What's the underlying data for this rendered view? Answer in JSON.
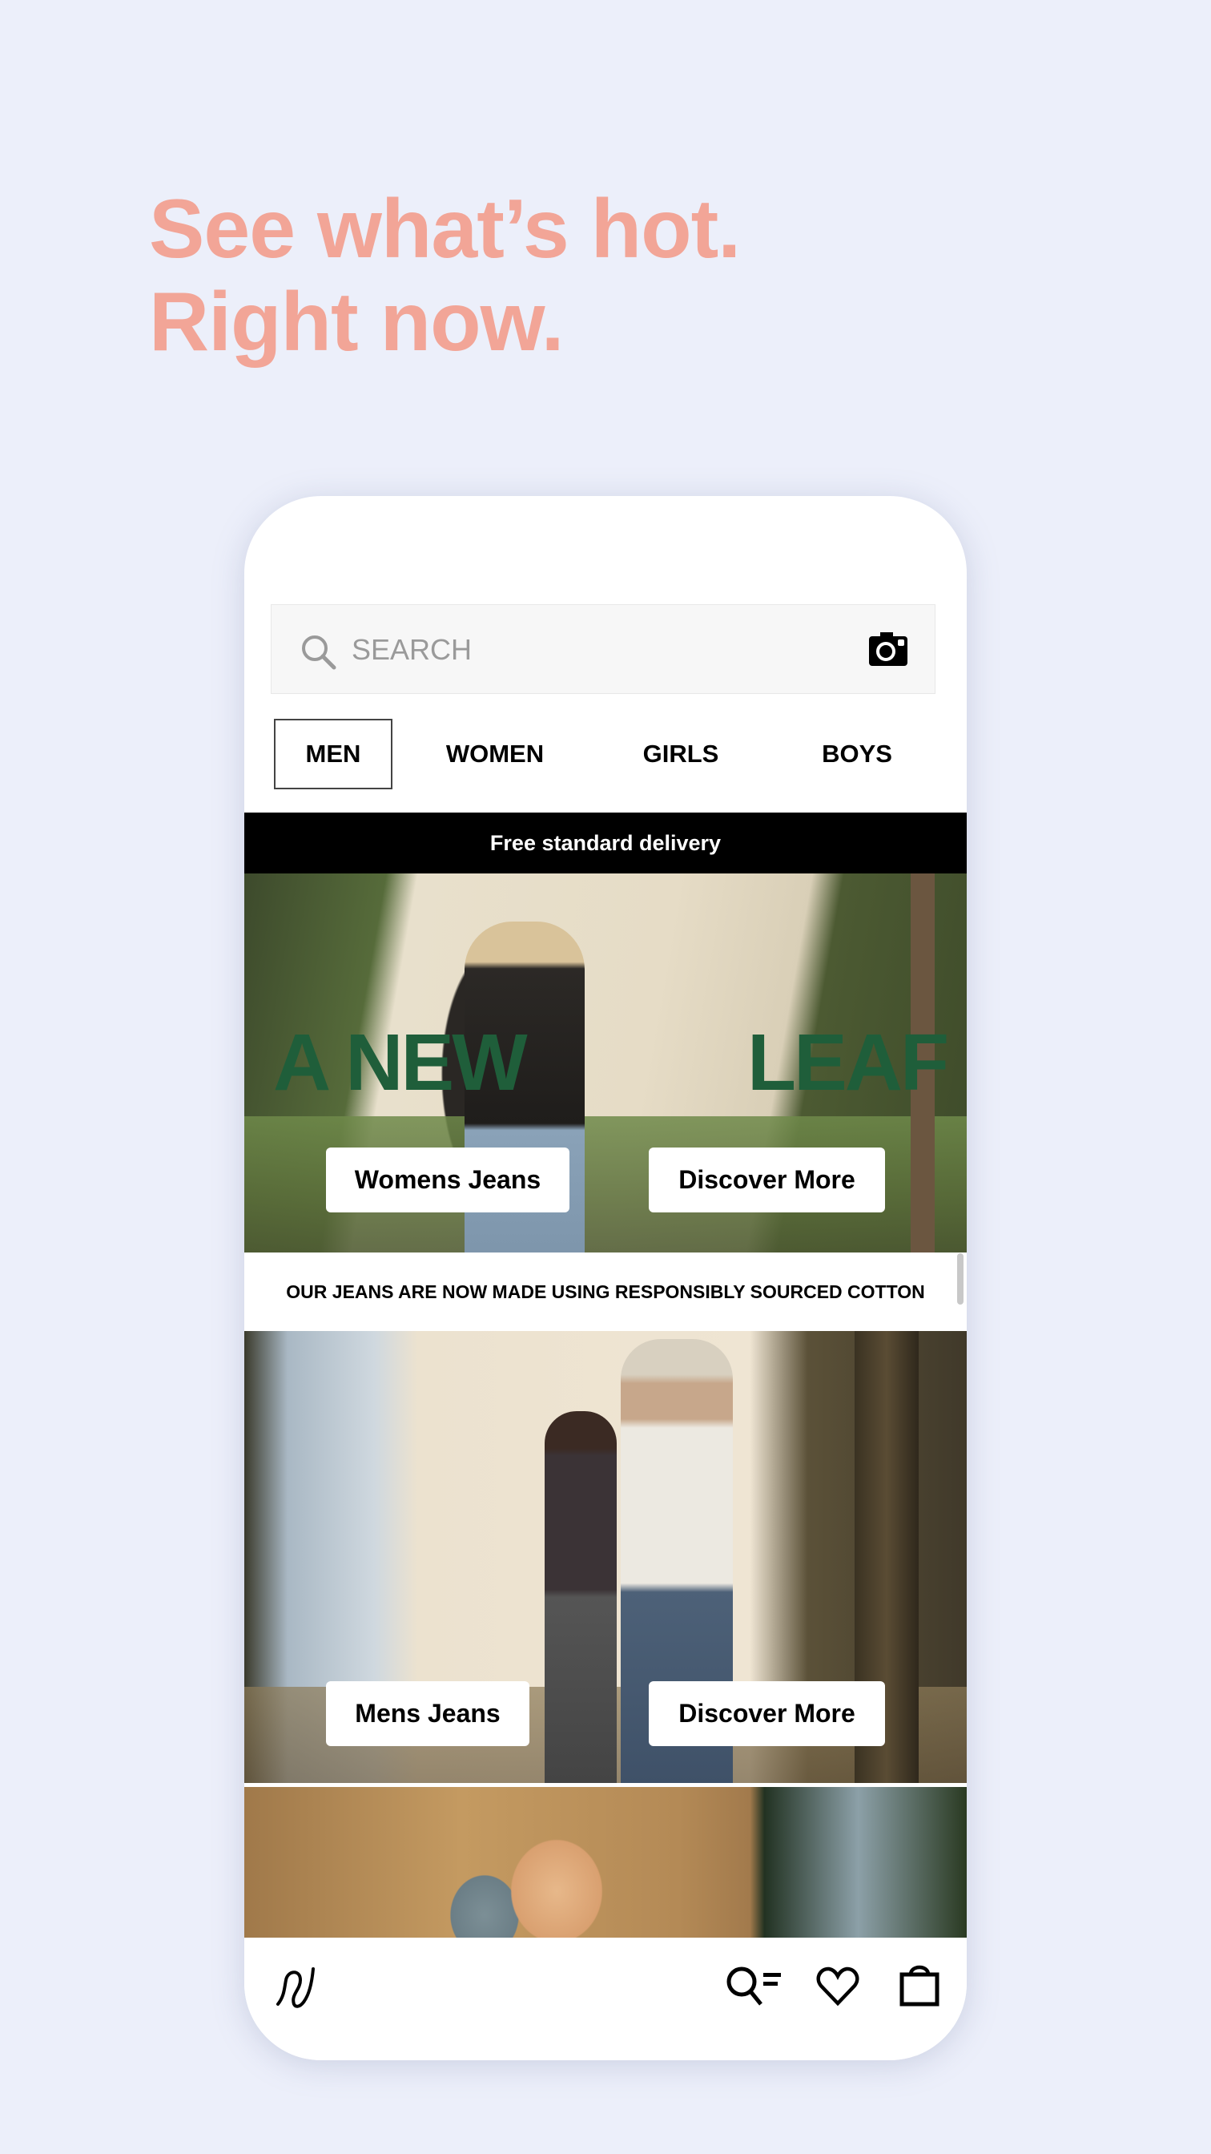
{
  "promo": {
    "headline_line1": "See what’s hot.",
    "headline_line2": "Right now.",
    "headline_color": "#F2A597",
    "background_color": "#ECEFFA"
  },
  "app": {
    "search": {
      "placeholder": "SEARCH",
      "value": "",
      "left_icon": "search-icon",
      "right_icon": "camera-icon"
    },
    "tabs": [
      {
        "label": "MEN",
        "active": true
      },
      {
        "label": "WOMEN",
        "active": false
      },
      {
        "label": "GIRLS",
        "active": false
      },
      {
        "label": "BOYS",
        "active": false
      }
    ],
    "delivery_banner": "Free standard delivery",
    "heroes": [
      {
        "overlay_text_left": "A NEW",
        "overlay_text_right": "LEAF",
        "overlay_color": "#1F5E3A",
        "buttons": [
          "Womens Jeans",
          "Discover More"
        ]
      },
      {
        "buttons": [
          "Mens Jeans",
          "Discover More"
        ]
      },
      {}
    ],
    "caption": "OUR JEANS ARE NOW MADE USING RESPONSIBLY SOURCED COTTON",
    "bottom_nav": [
      {
        "icon": "brand-logo-icon"
      },
      {
        "icon": "search-list-icon"
      },
      {
        "icon": "heart-icon"
      },
      {
        "icon": "bag-icon"
      }
    ]
  }
}
